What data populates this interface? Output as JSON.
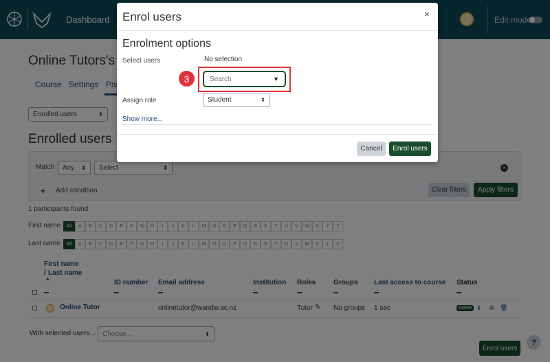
{
  "navbar": {
    "dashboard_label": "Dashboard",
    "edit_mode_label": "Edit mode",
    "bg_color": "#0c4b5a"
  },
  "page": {
    "course_title": "Online Tutors's",
    "tabs": [
      "Course",
      "Settings",
      "Par"
    ],
    "enrolment_dropdown": "Enrolled users",
    "heading": "Enrolled users",
    "filters": {
      "match_label": "Match",
      "match_value": "Any",
      "select_value": "Select",
      "add_condition": "Add condition",
      "clear_filters": "Clear filters",
      "apply_filters": "Apply filters"
    },
    "participants_found": "1 participants found",
    "first_name_label": "First name",
    "last_name_label": "Last name",
    "letters": [
      "All",
      "A",
      "B",
      "C",
      "D",
      "E",
      "F",
      "G",
      "H",
      "I",
      "J",
      "K",
      "L",
      "M",
      "N",
      "O",
      "P",
      "Q",
      "R",
      "S",
      "T",
      "U",
      "V",
      "W",
      "X",
      "Y",
      "Z"
    ],
    "table": {
      "headers": {
        "first_name": "First name",
        "slash": "/",
        "last_name": "Last name",
        "id_number": "ID number",
        "email": "Email address",
        "institution": "Institution",
        "roles": "Roles",
        "groups": "Groups",
        "last_access": "Last access to course",
        "status": "Status"
      },
      "rows": [
        {
          "name": "Online Tutor",
          "email": "onlinetutor@wandw.ac.nz",
          "role": "Tutor",
          "groups": "No groups",
          "last_access": "1 sec",
          "status": "Active"
        }
      ]
    },
    "with_selected_label": "With selected users...",
    "with_selected_value": "Choose...",
    "enrol_users_button": "Enrol users",
    "help_label": "?"
  },
  "modal": {
    "title": "Enrol users",
    "close_label": "×",
    "section_title": "Enrolment options",
    "select_users_label": "Select users",
    "no_selection": "No selection",
    "search_placeholder": "Search",
    "step_number": "3",
    "assign_role_label": "Assign role",
    "assign_role_value": "Student",
    "show_more": "Show more...",
    "cancel_label": "Cancel",
    "enrol_label": "Enrol users"
  },
  "colors": {
    "accent_green": "#1a4d2e",
    "highlight_red": "#e0323c",
    "link_blue": "#1f4e79"
  }
}
